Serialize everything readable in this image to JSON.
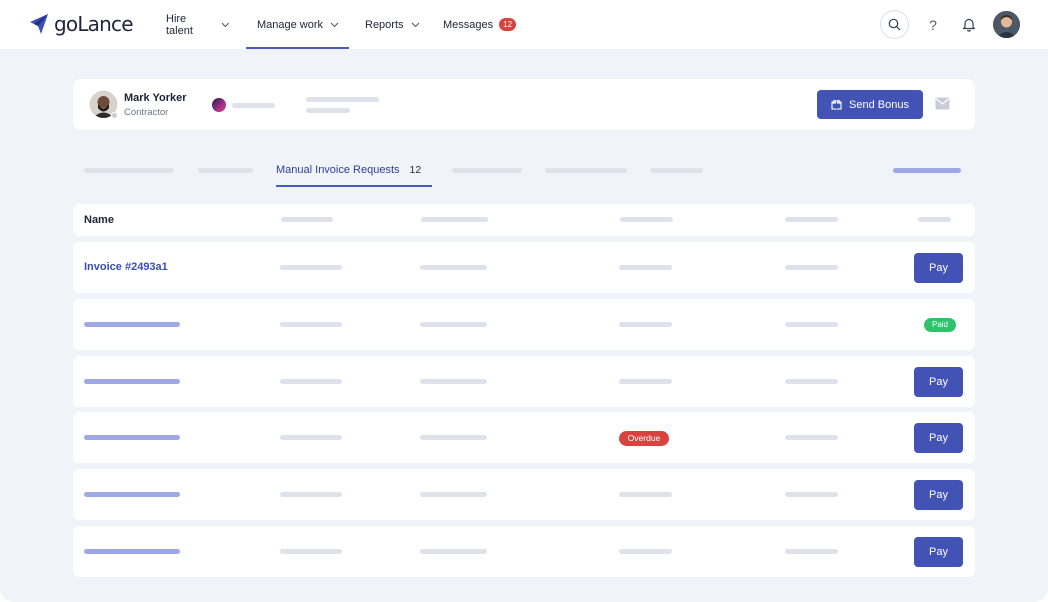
{
  "app": {
    "logo_text": "goLance"
  },
  "nav": {
    "items": [
      {
        "label": "Hire talent"
      },
      {
        "label": "Manage work"
      },
      {
        "label": "Reports"
      },
      {
        "label": "Messages",
        "badge": "12"
      }
    ]
  },
  "topbar": {
    "help_label": "?"
  },
  "profile": {
    "name": "Mark Yorker",
    "role": "Contractor",
    "send_bonus_label": "Send Bonus"
  },
  "tabs": {
    "active": {
      "label": "Manual Invoice Requests",
      "count": "12"
    }
  },
  "table": {
    "header_name": "Name",
    "rows": [
      {
        "name": "Invoice #2493a1",
        "action": "Pay"
      },
      {
        "status": "Paid"
      },
      {
        "action": "Pay"
      },
      {
        "status": "Overdue",
        "action": "Pay"
      },
      {
        "action": "Pay"
      },
      {
        "action": "Pay"
      }
    ]
  },
  "colors": {
    "accent": "#4253b5",
    "background": "#f0f3f8",
    "paid": "#2ec26a",
    "overdue": "#d9433f",
    "message_badge": "#d9433f"
  }
}
